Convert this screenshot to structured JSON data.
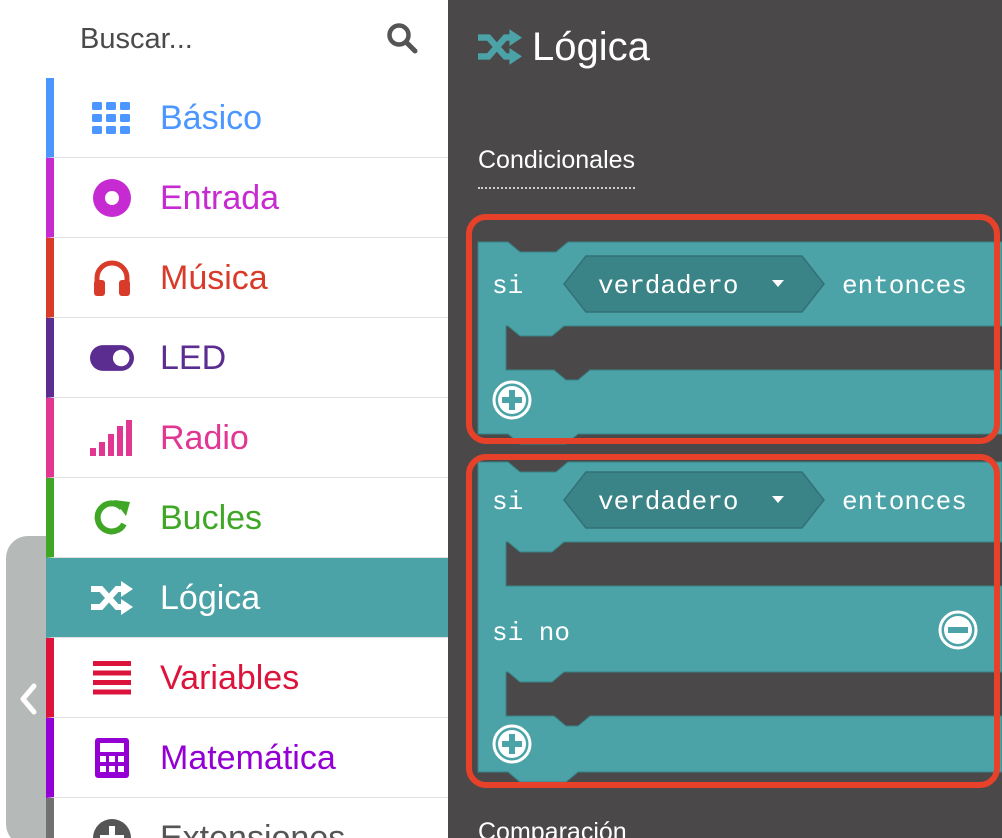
{
  "search": {
    "placeholder": "Buscar..."
  },
  "categories": [
    {
      "label": "Básico",
      "icon": "grid-icon",
      "color": "#4c97ff"
    },
    {
      "label": "Entrada",
      "icon": "target-icon",
      "color": "#c62bd1"
    },
    {
      "label": "Música",
      "icon": "headphones-icon",
      "color": "#d83b2a"
    },
    {
      "label": "LED",
      "icon": "toggle-icon",
      "color": "#5c2d91"
    },
    {
      "label": "Radio",
      "icon": "signal-bars-icon",
      "color": "#e23693"
    },
    {
      "label": "Bucles",
      "icon": "loop-arrow-icon",
      "color": "#3fa626"
    },
    {
      "label": "Lógica",
      "icon": "shuffle-icon",
      "color": "#4ba3a7",
      "selected": true
    },
    {
      "label": "Variables",
      "icon": "list-lines-icon",
      "color": "#dc143c"
    },
    {
      "label": "Matemática",
      "icon": "calculator-icon",
      "color": "#9400d3"
    },
    {
      "label": "Extensiones",
      "icon": "plus-circle-icon",
      "color": "#717171"
    }
  ],
  "flyout": {
    "title": "Lógica",
    "section_conditionals": "Condicionales",
    "section_comparison": "Comparación",
    "block_if": {
      "keyword": "si",
      "value": "verdadero",
      "then": "entonces"
    },
    "block_if_else": {
      "keyword": "si",
      "value": "verdadero",
      "then": "entonces",
      "else": "si no"
    }
  },
  "colors": {
    "block": "#4ba3a7",
    "block_dark": "#3a8387",
    "flyout_bg": "#4a4849",
    "highlight": "#e8412a"
  }
}
